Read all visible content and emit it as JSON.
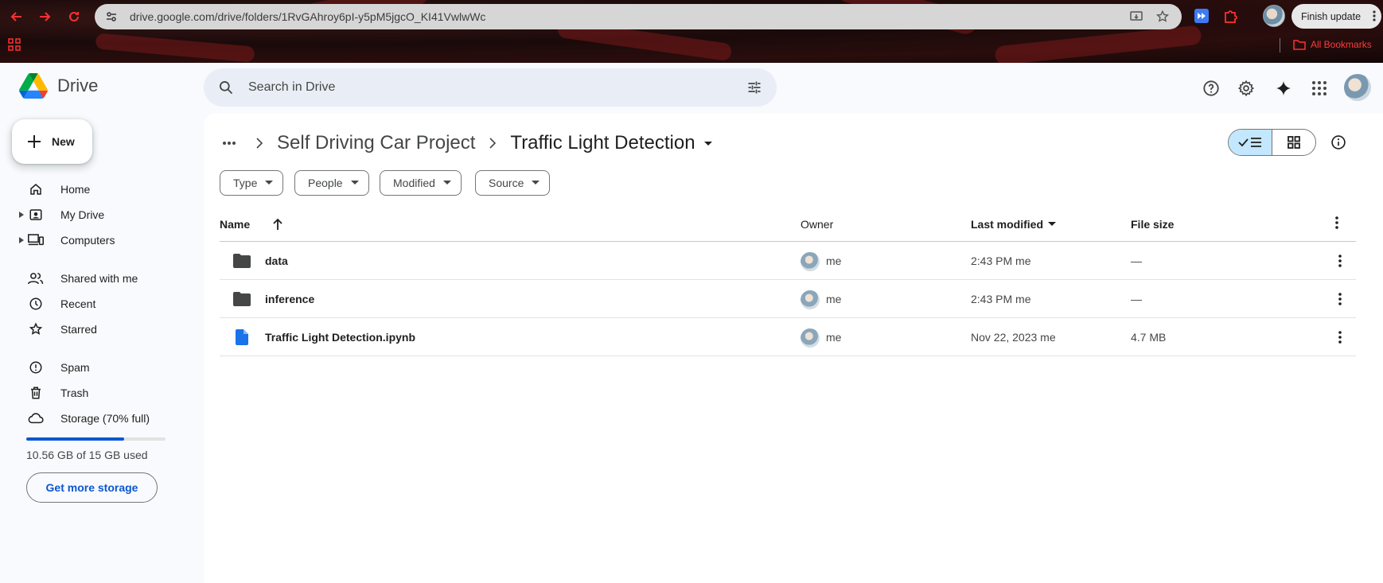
{
  "browser": {
    "url": "drive.google.com/drive/folders/1RvGAhroy6pI-y5pM5jgcO_KI41VwlwWc",
    "finish_update": "Finish update",
    "all_bookmarks": "All Bookmarks"
  },
  "drive": {
    "product_name": "Drive",
    "search_placeholder": "Search in Drive"
  },
  "sidebar": {
    "new_label": "New",
    "items": [
      {
        "label": "Home",
        "icon": "home-icon"
      },
      {
        "label": "My Drive",
        "icon": "my-drive-icon"
      },
      {
        "label": "Computers",
        "icon": "computers-icon"
      },
      {
        "label": "Shared with me",
        "icon": "shared-icon"
      },
      {
        "label": "Recent",
        "icon": "clock-icon"
      },
      {
        "label": "Starred",
        "icon": "star-icon"
      },
      {
        "label": "Spam",
        "icon": "spam-icon"
      },
      {
        "label": "Trash",
        "icon": "trash-icon"
      },
      {
        "label": "Storage (70% full)",
        "icon": "cloud-icon"
      }
    ],
    "storage_used_fraction": 0.7,
    "storage_text": "10.56 GB of 15 GB used",
    "get_more_storage": "Get more storage"
  },
  "breadcrumb": {
    "parent": "Self Driving Car Project",
    "current": "Traffic Light Detection"
  },
  "filters": [
    "Type",
    "People",
    "Modified",
    "Source"
  ],
  "table": {
    "columns": {
      "name": "Name",
      "owner": "Owner",
      "modified": "Last modified",
      "size": "File size"
    },
    "rows": [
      {
        "name": "data",
        "type": "folder",
        "owner": "me",
        "modified": "2:43 PM me",
        "size": "—"
      },
      {
        "name": "inference",
        "type": "folder",
        "owner": "me",
        "modified": "2:43 PM me",
        "size": "—"
      },
      {
        "name": "Traffic Light Detection.ipynb",
        "type": "file",
        "owner": "me",
        "modified": "Nov 22, 2023 me",
        "size": "4.7 MB"
      }
    ]
  },
  "colors": {
    "accent": "#0b57d0",
    "toggle_selected": "#c2e7ff",
    "search_bg": "#e9eef6",
    "page_bg": "#f8fafd"
  }
}
